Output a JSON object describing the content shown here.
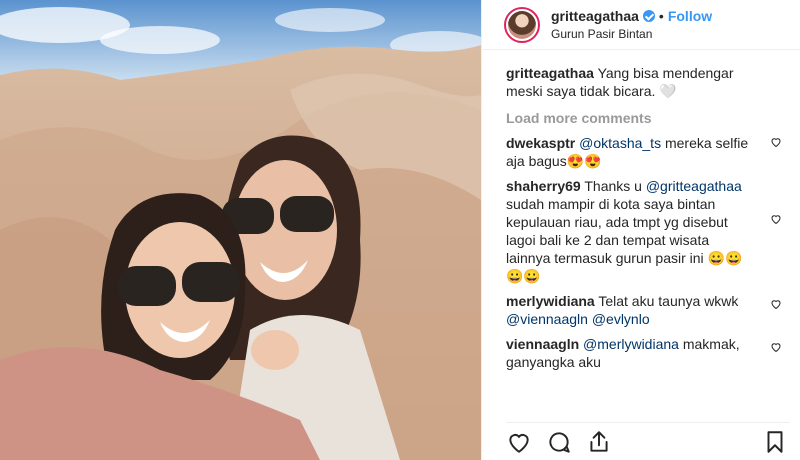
{
  "post": {
    "username": "gritteagathaa",
    "separator": "•",
    "follow_label": "Follow",
    "location": "Gurun Pasir Bintan",
    "photo": "two-women-selfie-desert"
  },
  "caption": {
    "username": "gritteagathaa",
    "text": "Yang bisa mendengar meski saya tidak bicara. 🤍"
  },
  "load_more_label": "Load more comments",
  "comments": [
    {
      "username": "dwekasptr",
      "mention": "@oktasha_ts",
      "text": " mereka selfie aja bagus😍😍"
    },
    {
      "username": "shaherry69",
      "pre": "Thanks u ",
      "mention": "@gritteagathaa",
      "text": " sudah mampir di kota saya bintan kepulauan riau, ada tmpt yg disebut lagoi bali ke 2 dan tempat wisata lainnya termasuk gurun pasir ini 😀😀😀😀"
    },
    {
      "username": "merlywidiana",
      "pre": "Telat aku taunya wkwk ",
      "mention": "@viennaagln",
      "mention2": "@evlynlo"
    },
    {
      "username": "viennaagln",
      "mention": "@merlywidiana",
      "text": " makmak, ganyangka aku"
    }
  ],
  "icons": {
    "like": "heart-icon",
    "comment": "comment-icon",
    "share": "share-icon",
    "save": "bookmark-icon",
    "verified": "verified-badge-icon"
  },
  "colors": {
    "accent": "#3897f0",
    "mention": "#003569",
    "muted": "#999999"
  }
}
